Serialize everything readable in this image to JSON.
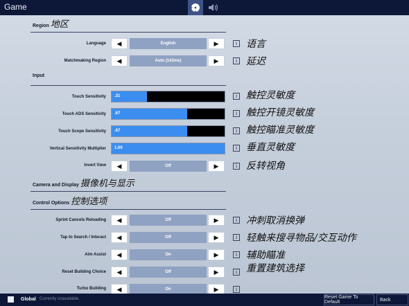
{
  "header": {
    "title": "Game",
    "tabs": [
      {
        "name": "settings",
        "icon": "gear-icon",
        "active": true
      },
      {
        "name": "audio",
        "icon": "speaker-icon",
        "active": false
      }
    ]
  },
  "sections": {
    "region": {
      "label": "Region",
      "note": "地区"
    },
    "input": {
      "label": "Input"
    },
    "camera": {
      "label": "Camera and Display",
      "note": "摄像机与显示"
    },
    "control": {
      "label": "Control Options",
      "note": "控制选项"
    }
  },
  "rows": {
    "language": {
      "label": "Language",
      "value": "English",
      "note": "语言"
    },
    "matchmaking": {
      "label": "Matchmaking Region",
      "value": "Auto (143ms)",
      "note": "延迟"
    },
    "touch_sensitivity": {
      "label": "Touch Sensitivity",
      "value": ".31",
      "fill_fraction": 0.31,
      "note": "触控灵敏度"
    },
    "touch_ads": {
      "label": "Touch ADS Sensitivity",
      "value": ".67",
      "fill_fraction": 0.67,
      "note": "触控开镜灵敏度"
    },
    "touch_scope": {
      "label": "Touch Scope Sensitivity",
      "value": ".67",
      "fill_fraction": 0.67,
      "note": "触控瞄准灵敏度"
    },
    "vertical_mult": {
      "label": "Vertical Sensitivity Multiplier",
      "value": "1.00",
      "fill_fraction": 1.0,
      "note": "垂直灵敏度"
    },
    "invert_view": {
      "label": "Invert View",
      "value": "Off",
      "note": "反转视角"
    },
    "sprint_cancels": {
      "label": "Sprint Cancels Reloading",
      "value": "Off",
      "note": "冲刺取消换弹"
    },
    "tap_search": {
      "label": "Tap to Search / Interact",
      "value": "Off",
      "note": "轻触来搜寻物品/交互动作"
    },
    "aim_assist": {
      "label": "Aim Assist",
      "value": "On",
      "note": "辅助瞄准"
    },
    "reset_building": {
      "label": "Reset Building Choice",
      "value": "Off",
      "note": "重置建筑选择"
    },
    "turbo_building": {
      "label": "Turbo Building",
      "value": "On"
    }
  },
  "arrows": {
    "left": "◀",
    "right": "▶"
  },
  "info_glyph": "i",
  "footer": {
    "global": "Global",
    "status": "Currently unavailable.",
    "reset": "Reset Game To Default",
    "back": "Back"
  }
}
